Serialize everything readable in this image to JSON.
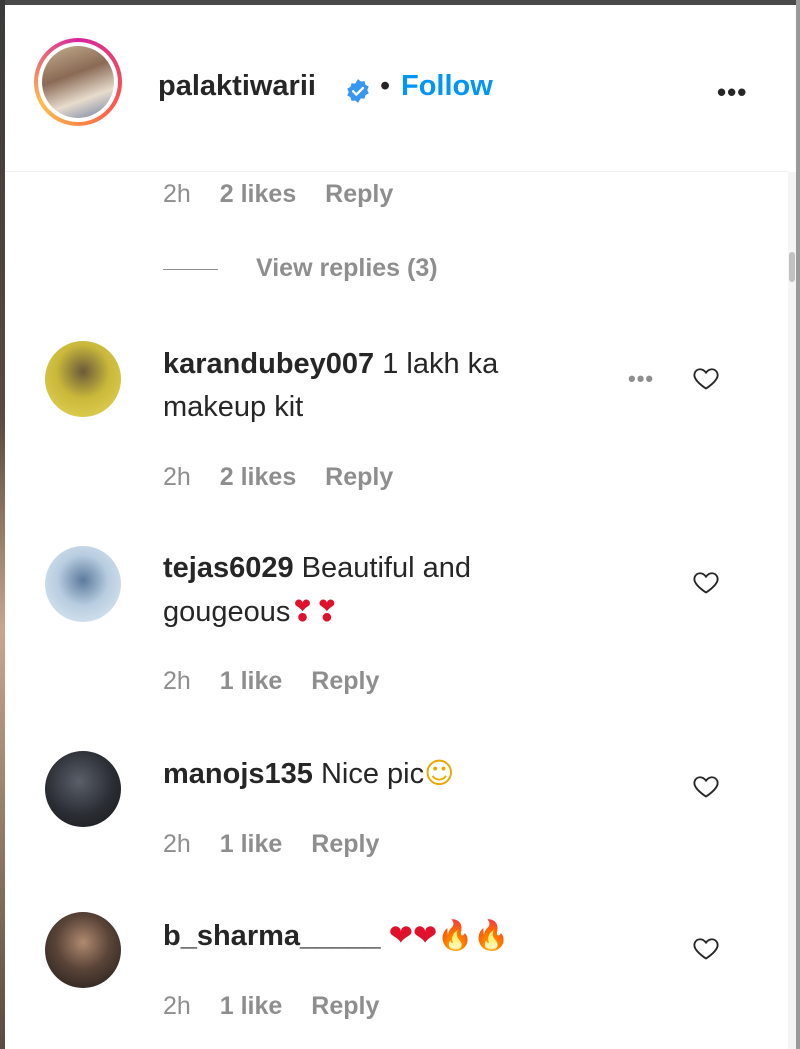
{
  "post": {
    "username": "palaktiwarii",
    "separator": "•",
    "follow_label": "Follow",
    "more_icon": "•••"
  },
  "top_meta": {
    "time": "2h",
    "likes": "2 likes",
    "reply": "Reply"
  },
  "view_replies": "View replies (3)",
  "comments": [
    {
      "username": "karandubey007",
      "text": " 1 lakh ka makeup kit",
      "time": "2h",
      "likes": "2 likes",
      "reply": "Reply",
      "more_icon": "•••"
    },
    {
      "username": "tejas6029",
      "text": " Beautiful and gougeous",
      "emoji": "❣❣",
      "time": "2h",
      "likes": "1 like",
      "reply": "Reply"
    },
    {
      "username": "manojs135",
      "text": " Nice pic",
      "emoji": "☺",
      "time": "2h",
      "likes": "1 like",
      "reply": "Reply"
    },
    {
      "username": "b_sharma_____",
      "text": " ",
      "emoji_hearts": "❤❤",
      "emoji_fire": "🔥🔥",
      "time": "2h",
      "likes": "1 like",
      "reply": "Reply"
    }
  ],
  "colors": {
    "link_blue": "#0095f6",
    "meta_gray": "#8e8e8e",
    "text": "#262626",
    "verified_blue": "#3897f0"
  },
  "icons": [
    "verified-badge-icon",
    "more-options-icon",
    "heart-outline-icon"
  ]
}
